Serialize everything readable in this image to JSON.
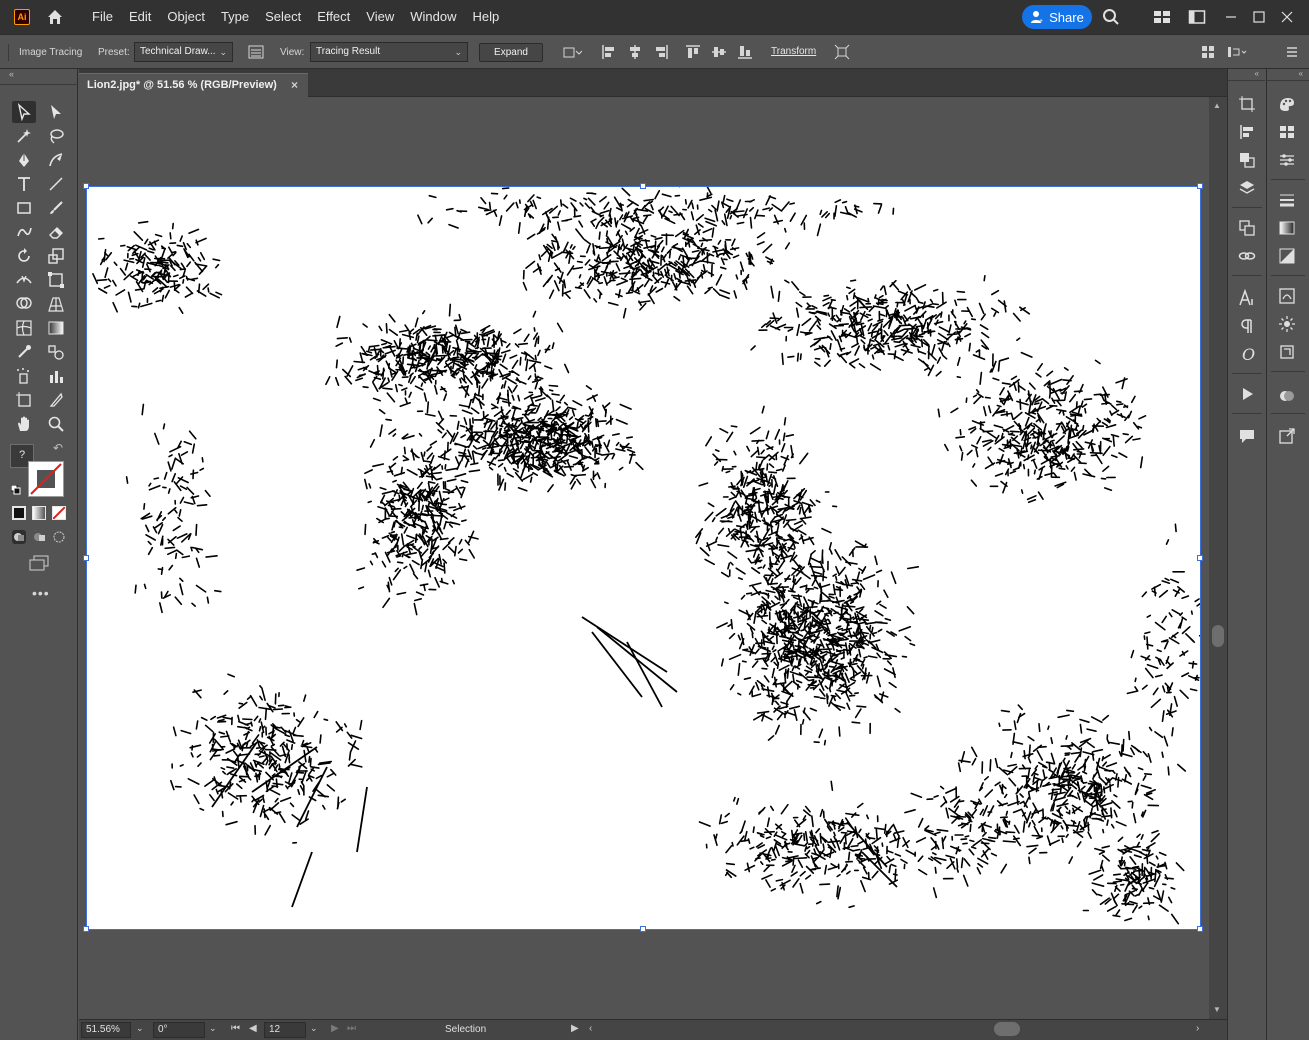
{
  "app": {
    "logo_text": "Ai"
  },
  "menu": [
    "File",
    "Edit",
    "Object",
    "Type",
    "Select",
    "Effect",
    "View",
    "Window",
    "Help"
  ],
  "share": {
    "label": "Share"
  },
  "control_bar": {
    "panel_label": "Image Tracing",
    "preset_label": "Preset:",
    "preset_value": "Technical Draw...",
    "view_label": "View:",
    "view_value": "Tracing Result",
    "expand_label": "Expand",
    "transform_label": "Transform"
  },
  "document": {
    "tab_title": "Lion2.jpg* @ 51.56 % (RGB/Preview)",
    "close_glyph": "×"
  },
  "status_bar": {
    "zoom": "51.56%",
    "rotation": "0°",
    "artboard_number": "12",
    "tool_name": "Selection"
  },
  "colors": {
    "ui_dark": "#323232",
    "ui_mid": "#535353",
    "accent": "#1473e6",
    "selection": "#3d6fd8",
    "ai_orange": "#ff9a00"
  }
}
